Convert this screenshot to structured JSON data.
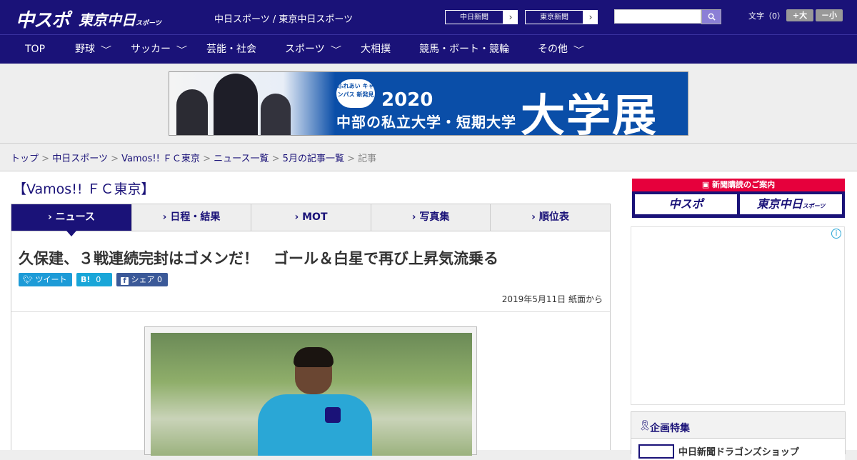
{
  "header": {
    "logo_primary": "中スポ",
    "logo_secondary": "東京中日",
    "logo_secondary_small": "スポーツ",
    "site_names": "中日スポーツ / 東京中日スポーツ",
    "paper_links": [
      {
        "label": "中日新聞",
        "arrow": "›"
      },
      {
        "label": "東京新聞",
        "arrow": "›"
      }
    ],
    "search": {
      "placeholder": "",
      "button_icon": "search-icon"
    },
    "font_size": {
      "label": "文字（0）",
      "increase": "+大",
      "decrease": "－小"
    }
  },
  "nav": {
    "items": [
      {
        "label": "TOP",
        "has_dropdown": false
      },
      {
        "label": "野球",
        "has_dropdown": true
      },
      {
        "label": "サッカー",
        "has_dropdown": true
      },
      {
        "label": "芸能・社会",
        "has_dropdown": false
      },
      {
        "label": "スポーツ",
        "has_dropdown": true
      },
      {
        "label": "大相撲",
        "has_dropdown": false
      },
      {
        "label": "競馬・ボート・競輪",
        "has_dropdown": false
      },
      {
        "label": "その他",
        "has_dropdown": true
      }
    ],
    "chevron": "﹀"
  },
  "banner": {
    "badge": "ふれあい キャンパス 新発見",
    "year": "2020",
    "subtitle": "中部の私立大学・短期大学",
    "title": "大学展"
  },
  "breadcrumb": {
    "items": [
      "トップ",
      "中日スポーツ",
      "Vamos!! ＦＣ東京",
      "ニュース一覧",
      "5月の記事一覧"
    ],
    "current": "記事",
    "separator": ">"
  },
  "section": {
    "title": "【Vamos!! ＦＣ東京】"
  },
  "tabs": [
    {
      "label": "ニュース",
      "active": true
    },
    {
      "label": "日程・結果",
      "active": false
    },
    {
      "label": "MOT",
      "active": false
    },
    {
      "label": "写真集",
      "active": false
    },
    {
      "label": "順位表",
      "active": false
    }
  ],
  "tab_marker": "›",
  "article": {
    "headline": "久保建、３戦連続完封はゴメンだ！　ゴール＆白星で再び上昇気流乗る",
    "share": {
      "tweet": "ツイート",
      "hatena_icon": "B!",
      "hatena_count": "0",
      "facebook_label": "シェア",
      "facebook_count": "0"
    },
    "date_line": "2019年5月11日 紙面から"
  },
  "sidebar": {
    "subscription_head": "新聞購読のご案内",
    "subscription_logos": [
      "中スポ",
      "東京中日"
    ],
    "subscription_logo_small": "スポーツ",
    "ad_info_icon": "i",
    "feature_title": "企画特集",
    "feature_item": "中日新聞ドラゴンズショップ"
  },
  "colors": {
    "brand": "#1a1278",
    "accent_red": "#e6003c",
    "twitter": "#1d9bd7",
    "facebook": "#3b5998"
  }
}
